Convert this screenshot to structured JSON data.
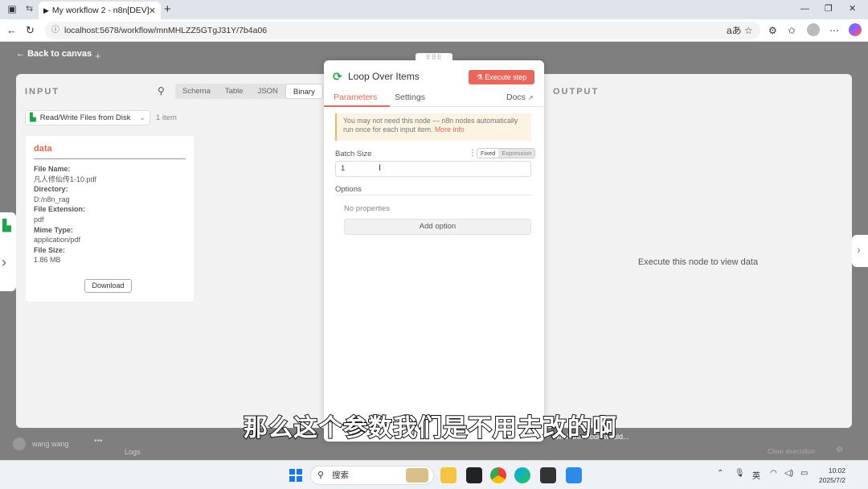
{
  "browser": {
    "tab_title": "My workflow 2 - n8n[DEV]",
    "tab_close": "✕",
    "new_tab": "+",
    "url": "localhost:5678/workflow/mnMHLZZ5GTgJ31Y/7b4a06"
  },
  "app": {
    "back_label": "Back to canvas"
  },
  "input": {
    "label": "INPUT",
    "view_tabs": [
      "Schema",
      "Table",
      "JSON",
      "Binary"
    ],
    "active_tab": "Binary",
    "node_selector": "Read/Write Files from Disk",
    "item_count": "1 item",
    "card": {
      "title": "data",
      "fields": [
        {
          "key": "File Name:",
          "value": "凡人修仙传1-10.pdf"
        },
        {
          "key": "Directory:",
          "value": "D:/n8n_rag"
        },
        {
          "key": "File Extension:",
          "value": "pdf"
        },
        {
          "key": "Mime Type:",
          "value": "application/pdf"
        },
        {
          "key": "File Size:",
          "value": "1.86 MB"
        }
      ],
      "download_label": "Download"
    }
  },
  "node": {
    "title": "Loop Over Items",
    "execute_label": "Execute step",
    "tabs": {
      "parameters": "Parameters",
      "settings": "Settings",
      "docs": "Docs"
    },
    "notice_text": "You may not need this node — n8n nodes automatically run once for each input item.",
    "notice_link": "More info",
    "batch_size_label": "Batch Size",
    "mode_fixed": "Fixed",
    "mode_expression": "Expression",
    "batch_size_value": "1",
    "options_label": "Options",
    "no_properties": "No properties",
    "add_option_label": "Add option"
  },
  "output": {
    "label": "OUTPUT",
    "empty_message": "Execute this node to view data"
  },
  "footer": {
    "user_name": "wang wang",
    "logs_label": "Logs",
    "feedback": "I wish this node would...",
    "clear_execution": "Clear execution"
  },
  "subtitle": "那么这个参数我们是不用去改的啊",
  "taskbar": {
    "search_placeholder": "搜索",
    "ime": "英",
    "time": "10:02",
    "date": "2025/7/2"
  },
  "colors": {
    "accent": "#e8665a",
    "node_green": "#22a34a"
  }
}
